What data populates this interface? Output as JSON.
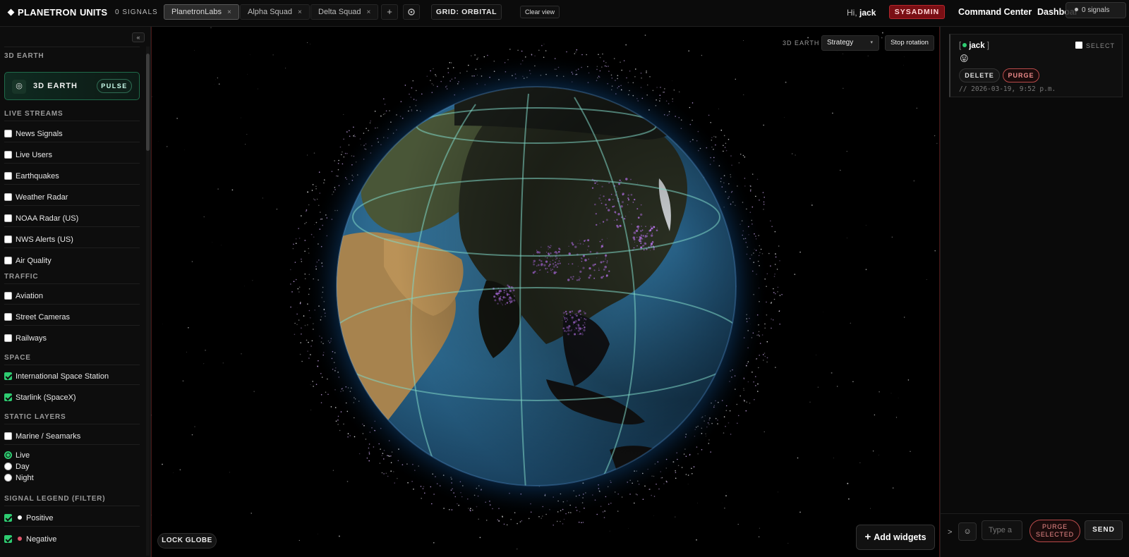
{
  "header": {
    "brand": "PLANETRON",
    "units": "UNITS",
    "signals": "0 SIGNALS",
    "tabs": [
      {
        "label": "PlanetronLabs",
        "active": true
      },
      {
        "label": "Alpha Squad",
        "active": false
      },
      {
        "label": "Delta Squad",
        "active": false
      }
    ],
    "close_glyph": "×",
    "add_tab_glyph": "+",
    "grid_label": "GRID: ORBITAL",
    "clear_view": "Clear view",
    "greeting": "Hi,",
    "username": "jack",
    "role_badge": "SYSADMIN",
    "nav": {
      "command_center": "Command Center",
      "dashboard": "Dashboard"
    },
    "signals_pill": "0 signals"
  },
  "sidebar": {
    "collapse_glyph": "«",
    "section_3d": "3D EARTH",
    "earth_card": {
      "label": "3D EARTH",
      "pulse": "PULSE"
    },
    "sections": {
      "live_streams": "LIVE STREAMS",
      "traffic": "TRAFFIC",
      "space": "SPACE",
      "static_layers": "STATIC LAYERS",
      "signal_legend": "SIGNAL LEGEND (FILTER)"
    },
    "live_streams": [
      {
        "label": "News Signals",
        "checked": false
      },
      {
        "label": "Live Users",
        "checked": false
      },
      {
        "label": "Earthquakes",
        "checked": false
      },
      {
        "label": "Weather Radar",
        "checked": false
      },
      {
        "label": "NOAA Radar (US)",
        "checked": false
      },
      {
        "label": "NWS Alerts (US)",
        "checked": false
      },
      {
        "label": "Air Quality",
        "checked": false
      }
    ],
    "traffic": [
      {
        "label": "Aviation",
        "checked": false
      },
      {
        "label": "Street Cameras",
        "checked": false
      },
      {
        "label": "Railways",
        "checked": false
      }
    ],
    "space": [
      {
        "label": "International Space Station",
        "checked": true
      },
      {
        "label": "Starlink (SpaceX)",
        "checked": true
      }
    ],
    "static_layers": [
      {
        "label": "Marine / Seamarks",
        "checked": false
      }
    ],
    "lighting": [
      {
        "label": "Live",
        "selected": true
      },
      {
        "label": "Day",
        "selected": false
      },
      {
        "label": "Night",
        "selected": false
      }
    ],
    "legend": [
      {
        "label": "Positive",
        "checked": true,
        "color": "#ffffff"
      },
      {
        "label": "Negative",
        "checked": true,
        "color": "#e0556a"
      }
    ]
  },
  "map": {
    "view_label": "3D EARTH",
    "strategy": "Strategy",
    "stop_rotation": "Stop rotation",
    "lock_globe": "LOCK GLOBE",
    "add_widgets": "Add widgets",
    "colors": {
      "ocean": "#2e6e96",
      "atmosphere": "#1e7fd0",
      "graticule": "#7fd6c4",
      "city_lights": "#c77dff"
    }
  },
  "chat": {
    "message": {
      "author": "jack",
      "emoji": "😛",
      "select_label": "SELECT",
      "delete_label": "DELETE",
      "purge_label": "PURGE",
      "timestamp": "// 2026-03-19, 9:52 p.m."
    },
    "composer": {
      "prompt": ">",
      "emoji_glyph": "☺",
      "placeholder": "Type a",
      "purge_selected_line1": "PURGE",
      "purge_selected_line2": "SELECTED",
      "send": "SEND"
    }
  }
}
